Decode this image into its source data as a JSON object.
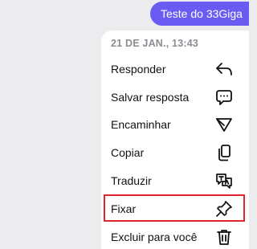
{
  "message": {
    "text": "Teste do 33Giga",
    "bubble_color": "#6a5cf2"
  },
  "menu": {
    "date": "21 DE JAN., 13:43",
    "items": [
      {
        "label": "Responder",
        "icon": "reply-icon"
      },
      {
        "label": "Salvar resposta",
        "icon": "chat-bubble-icon"
      },
      {
        "label": "Encaminhar",
        "icon": "send-icon"
      },
      {
        "label": "Copiar",
        "icon": "copy-icon"
      },
      {
        "label": "Traduzir",
        "icon": "translate-icon"
      },
      {
        "label": "Fixar",
        "icon": "pin-icon",
        "highlighted": true
      },
      {
        "label": "Excluir para você",
        "icon": "trash-icon"
      }
    ]
  },
  "colors": {
    "highlight_border": "#e0262a",
    "background": "#ececee",
    "menu_background": "#ffffff"
  }
}
